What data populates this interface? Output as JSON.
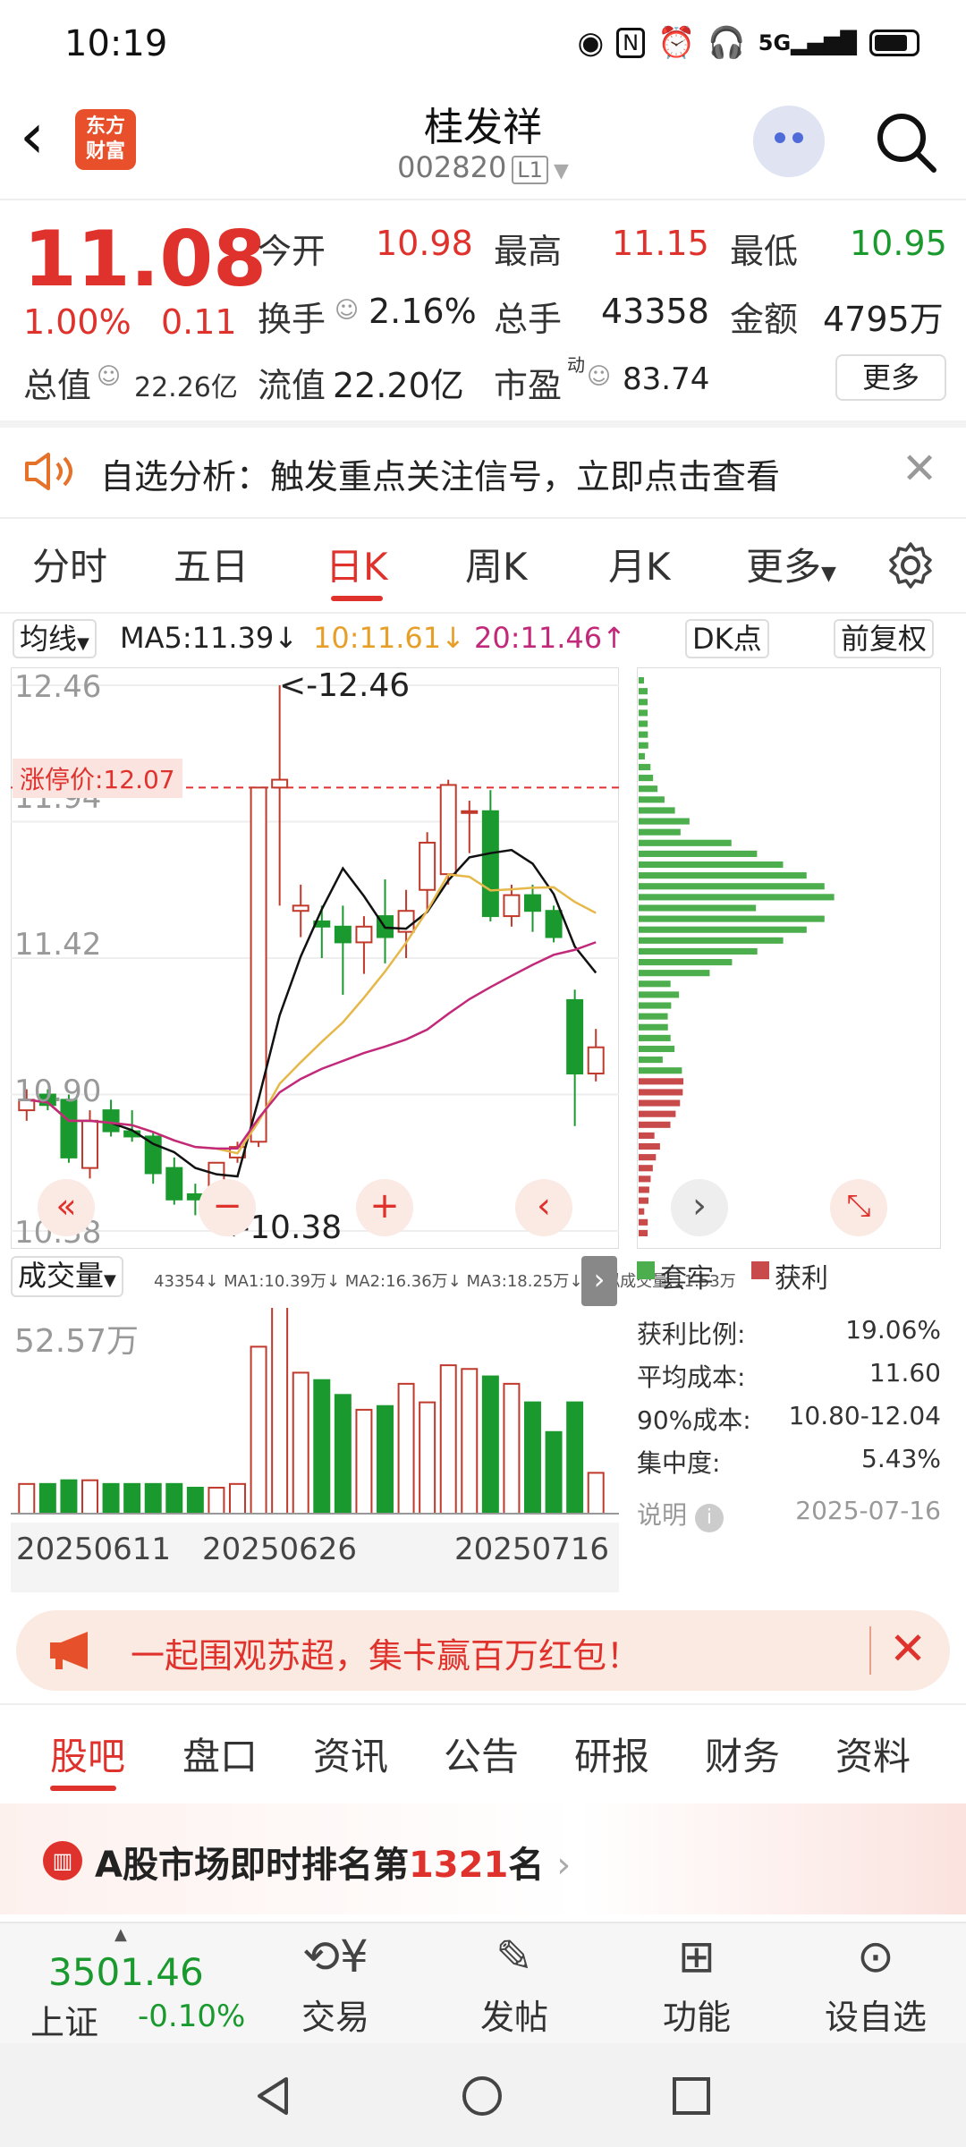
{
  "status_bar": {
    "time": "10:19",
    "icons": [
      "eye-icon",
      "nfc-icon",
      "alarm-icon",
      "headphones-icon",
      "5g-signal-icon",
      "battery-icon"
    ]
  },
  "header": {
    "logo_line1": "东方",
    "logo_line2": "财富",
    "stock_name": "桂发祥",
    "stock_code": "002820",
    "level_badge": "L1"
  },
  "quote": {
    "price": "11.08",
    "change_pct": "1.00%",
    "change": "0.11",
    "open_label": "今开",
    "open": "10.98",
    "high_label": "最高",
    "high": "11.15",
    "low_label": "最低",
    "low": "10.95",
    "turnover_label": "换手",
    "turnover": "2.16%",
    "volume_label": "总手",
    "volume": "43358",
    "amount_label": "金额",
    "amount": "4795万",
    "mktcap_label": "总值",
    "mktcap": "22.26亿",
    "float_label": "流值",
    "float_cap": "22.20亿",
    "pe_label": "市盈",
    "pe_sup": "动",
    "pe": "83.74",
    "more": "更多"
  },
  "analysis_banner": {
    "text": "自选分析：触发重点关注信号，立即点击查看"
  },
  "tabs": [
    "分时",
    "五日",
    "日K",
    "周K",
    "月K",
    "更多"
  ],
  "active_tab": "日K",
  "chart_toolbar": {
    "ma_selector": "均线",
    "ma5": "MA5:11.39↓",
    "ma10": "10:11.61↓",
    "ma20": "20:11.46↑",
    "dk_button": "DK点",
    "adjust_button": "前复权"
  },
  "kline": {
    "y_top": "12.46",
    "y_mid1": "11.94",
    "y_mid2": "11.42",
    "y_mid3": "10.90",
    "y_bottom": "10.38",
    "max_label": "<-12.46",
    "min_label": "<-10.38",
    "limit_label": "涨停价:12.07"
  },
  "volume_bar": {
    "selector": "成交量",
    "info": "43354↓ MA1:10.39万↓ MA2:16.36万↓ MA3:18.25万↓ 虚拟成交量:11.53万",
    "y_top": "52.57万",
    "dates": [
      "20250611",
      "20250626",
      "20250716"
    ]
  },
  "chip_panel": {
    "legend_trapped": "套牢",
    "legend_profit": "获利",
    "profit_ratio_label": "获利比例:",
    "profit_ratio": "19.06%",
    "avg_cost_label": "平均成本:",
    "avg_cost": "11.60",
    "cost90_label": "90%成本:",
    "cost90": "10.80-12.04",
    "concentration_label": "集中度:",
    "concentration": "5.43%",
    "note_label": "说明",
    "date": "2025-07-16"
  },
  "ad_banner": {
    "text": "一起围观苏超，集卡赢百万红包！"
  },
  "info_tabs": [
    "股吧",
    "盘口",
    "资讯",
    "公告",
    "研报",
    "财务",
    "资料"
  ],
  "rank": {
    "prefix": "A股市场即时排名第",
    "number": "1321",
    "suffix": "名"
  },
  "bottom_bar": {
    "index_value": "3501.46",
    "index_name": "上证",
    "index_change": "-0.10%",
    "items": [
      "交易",
      "发帖",
      "功能",
      "设自选"
    ]
  },
  "colors": {
    "up": "#e0322c",
    "down": "#1a9a2e",
    "accent": "#e0322c"
  },
  "chart_data": {
    "type": "candlestick",
    "ylim": [
      10.38,
      12.46
    ],
    "dates_shown": [
      "20250611",
      "20250626",
      "20250716"
    ],
    "candles": [
      {
        "o": 10.84,
        "h": 10.92,
        "l": 10.8,
        "c": 10.88
      },
      {
        "o": 10.9,
        "h": 10.92,
        "l": 10.84,
        "c": 10.86
      },
      {
        "o": 10.88,
        "h": 10.9,
        "l": 10.64,
        "c": 10.66
      },
      {
        "o": 10.62,
        "h": 10.84,
        "l": 10.58,
        "c": 10.8
      },
      {
        "o": 10.84,
        "h": 10.88,
        "l": 10.74,
        "c": 10.76
      },
      {
        "o": 10.76,
        "h": 10.84,
        "l": 10.72,
        "c": 10.74
      },
      {
        "o": 10.74,
        "h": 10.76,
        "l": 10.56,
        "c": 10.6
      },
      {
        "o": 10.62,
        "h": 10.66,
        "l": 10.48,
        "c": 10.5
      },
      {
        "o": 10.52,
        "h": 10.56,
        "l": 10.44,
        "c": 10.5
      },
      {
        "o": 10.5,
        "h": 10.64,
        "l": 10.38,
        "c": 10.64
      },
      {
        "o": 10.66,
        "h": 10.72,
        "l": 10.64,
        "c": 10.7
      },
      {
        "o": 10.72,
        "h": 12.07,
        "l": 10.7,
        "c": 12.07
      },
      {
        "o": 12.07,
        "h": 12.46,
        "l": 11.62,
        "c": 12.1
      },
      {
        "o": 11.6,
        "h": 11.7,
        "l": 11.5,
        "c": 11.62
      },
      {
        "o": 11.56,
        "h": 11.62,
        "l": 11.42,
        "c": 11.54
      },
      {
        "o": 11.54,
        "h": 11.62,
        "l": 11.28,
        "c": 11.48
      },
      {
        "o": 11.48,
        "h": 11.58,
        "l": 11.36,
        "c": 11.54
      },
      {
        "o": 11.58,
        "h": 11.72,
        "l": 11.4,
        "c": 11.5
      },
      {
        "o": 11.52,
        "h": 11.68,
        "l": 11.42,
        "c": 11.6
      },
      {
        "o": 11.68,
        "h": 11.9,
        "l": 11.6,
        "c": 11.86
      },
      {
        "o": 11.74,
        "h": 12.1,
        "l": 11.7,
        "c": 12.08
      },
      {
        "o": 11.98,
        "h": 12.02,
        "l": 11.82,
        "c": 11.98
      },
      {
        "o": 11.98,
        "h": 12.06,
        "l": 11.56,
        "c": 11.58
      },
      {
        "o": 11.58,
        "h": 11.7,
        "l": 11.54,
        "c": 11.66
      },
      {
        "o": 11.66,
        "h": 11.7,
        "l": 11.52,
        "c": 11.6
      },
      {
        "o": 11.6,
        "h": 11.62,
        "l": 11.48,
        "c": 11.5
      },
      {
        "o": 11.26,
        "h": 11.3,
        "l": 10.78,
        "c": 10.98
      },
      {
        "o": 10.98,
        "h": 11.15,
        "l": 10.95,
        "c": 11.08
      }
    ],
    "volumes": [
      8,
      8,
      9,
      9,
      8,
      8,
      8,
      8,
      7,
      7,
      8,
      45,
      66,
      38,
      36,
      32,
      28,
      29,
      35,
      30,
      40,
      39,
      37,
      35,
      30,
      22,
      30,
      11
    ],
    "volume_ymax": 52.57,
    "chip_distribution": {
      "profit_ratio": 19.06,
      "avg_cost": 11.6,
      "cost_90": [
        10.8,
        12.04
      ],
      "concentration": 5.43
    }
  }
}
